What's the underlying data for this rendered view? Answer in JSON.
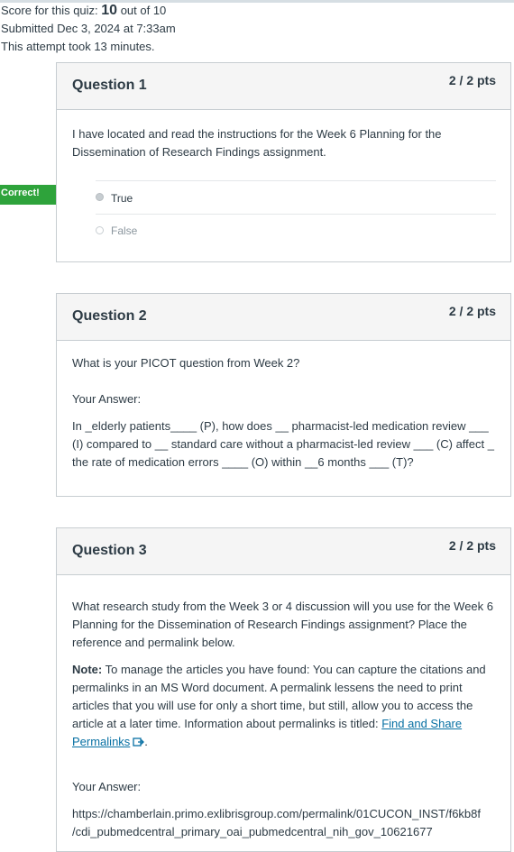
{
  "summary": {
    "score_prefix": "Score for this quiz: ",
    "score_value": "10",
    "score_suffix": " out of 10",
    "submitted": "Submitted Dec 3, 2024 at 7:33am",
    "duration": "This attempt took 13 minutes."
  },
  "questions": [
    {
      "title": "Question 1",
      "points": "2 / 2 pts",
      "text": "I have located and read the instructions for the Week 6 Planning for the Dissemination of Research Findings assignment.",
      "correct_label": "Correct!",
      "options": [
        {
          "label": "True",
          "selected": true
        },
        {
          "label": "False",
          "selected": false
        }
      ]
    },
    {
      "title": "Question 2",
      "points": "2 / 2 pts",
      "text": "What is your PICOT question from Week 2?",
      "your_answer_label": "Your Answer:",
      "answer": "In _elderly patients____ (P), how does __ pharmacist-led medication review ___ (I) compared to __ standard care without a pharmacist-led review ___ (C) affect _ the rate of medication errors ____ (O) within __6 months ___ (T)?"
    },
    {
      "title": "Question 3",
      "points": "2 / 2 pts",
      "text": "What research study from the Week 3 or 4 discussion will you use for the Week 6 Planning for the Dissemination of Research Findings assignment? Place the reference and permalink below.",
      "note_label": "Note:",
      "note_text": " To manage the articles you have found: You can capture the citations and permalinks in an MS Word document. A permalink lessens the need to print articles that you will use for only a short time, but still, allow you to access the article at a later time. Information about permalinks is titled: ",
      "note_link": "Find and Share Permalinks",
      "note_end": ".",
      "your_answer_label": "Your Answer:",
      "answer_line1": "https://chamberlain.primo.exlibrisgroup.com/permalink/01CUCON_INST/f6kb8f",
      "answer_line2": "/cdi_pubmedcentral_primary_oai_pubmedcentral_nih_gov_10621677"
    }
  ],
  "colors": {
    "correct": "#2ea33b",
    "link": "#0770a3",
    "header_bg": "#f5f5f5",
    "border": "#c7cdd1"
  },
  "icons": [
    "external-link-icon",
    "radio-selected-icon",
    "radio-empty-icon"
  ]
}
